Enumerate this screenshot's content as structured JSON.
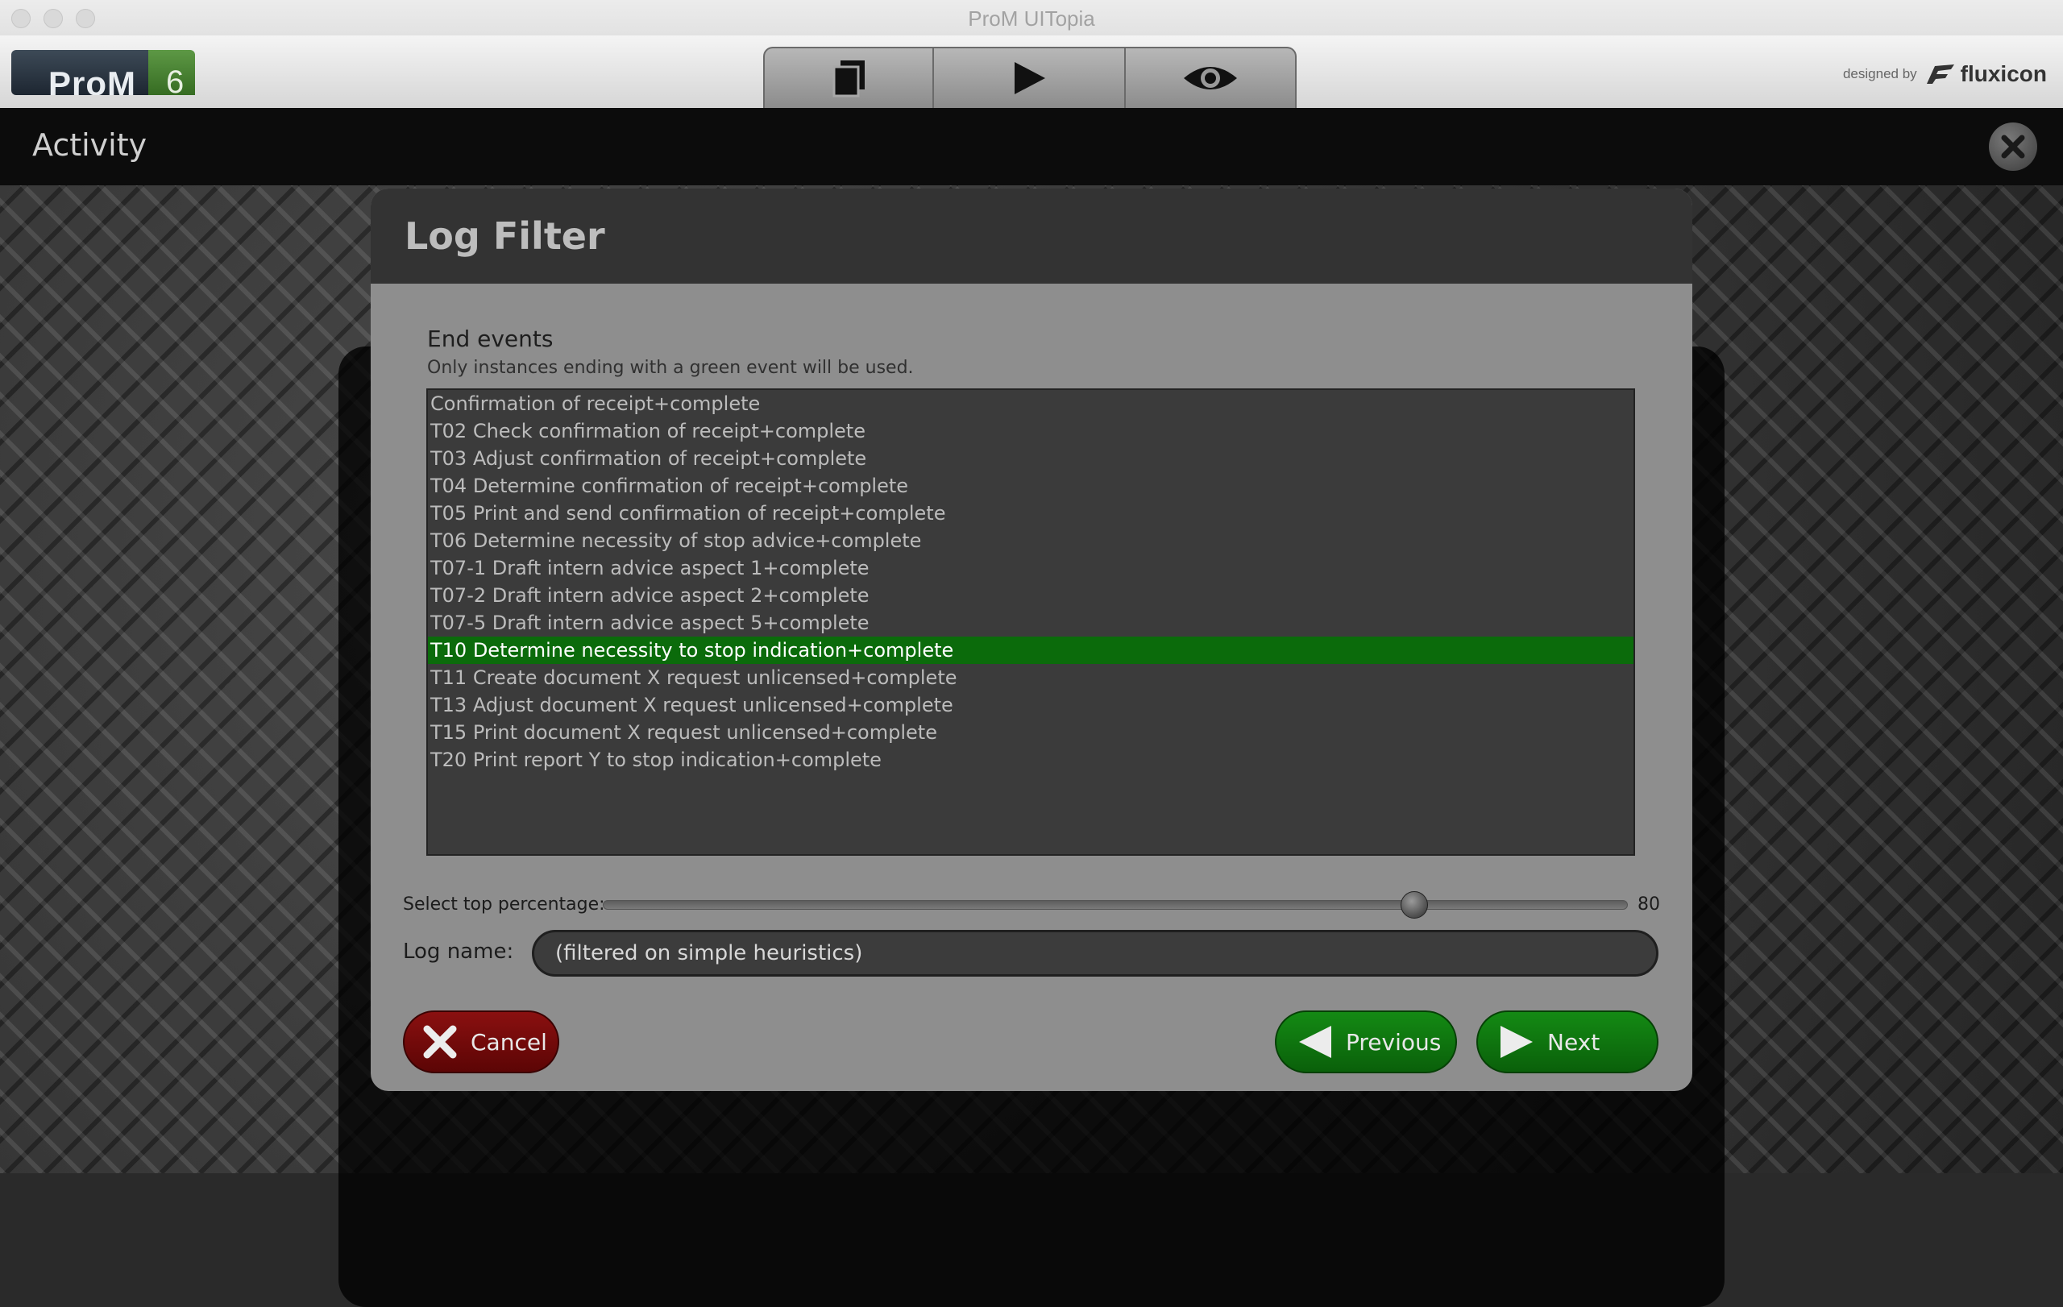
{
  "window": {
    "title": "ProM UITopia"
  },
  "header": {
    "logo_text": "ProM",
    "logo_version": "6",
    "mode_tabs": [
      "workspace-icon",
      "play-icon",
      "eye-icon"
    ],
    "credit_prefix": "designed by",
    "credit_name": "fluxicon"
  },
  "activity": {
    "title": "Activity"
  },
  "dialog": {
    "title": "Log Filter",
    "section_title": "End events",
    "section_subtitle": "Only instances ending with a green event will be used.",
    "events": [
      "Confirmation of receipt+complete",
      "T02 Check confirmation of receipt+complete",
      "T03 Adjust confirmation of receipt+complete",
      "T04 Determine confirmation of receipt+complete",
      "T05 Print and send confirmation of receipt+complete",
      "T06 Determine necessity of stop advice+complete",
      "T07-1 Draft intern advice aspect 1+complete",
      "T07-2 Draft intern advice aspect 2+complete",
      "T07-5 Draft intern advice aspect 5+complete",
      "T10 Determine necessity to stop indication+complete",
      "T11 Create document X request unlicensed+complete",
      "T13 Adjust document X request unlicensed+complete",
      "T15 Print document X request unlicensed+complete",
      "T20 Print report Y to stop indication+complete"
    ],
    "selected_event": "T10 Determine necessity to stop indication+complete",
    "slider_label": "Select top percentage:",
    "slider_value": "80",
    "slider_fraction": 0.8,
    "logname_label": "Log name:",
    "logname_value": "(filtered on simple heuristics)",
    "cancel_label": "Cancel",
    "previous_label": "Previous",
    "next_label": "Next"
  },
  "colors": {
    "selected_row": "#0b6b0b",
    "cancel_button": "#7a0c0c",
    "nav_button": "#107510"
  }
}
